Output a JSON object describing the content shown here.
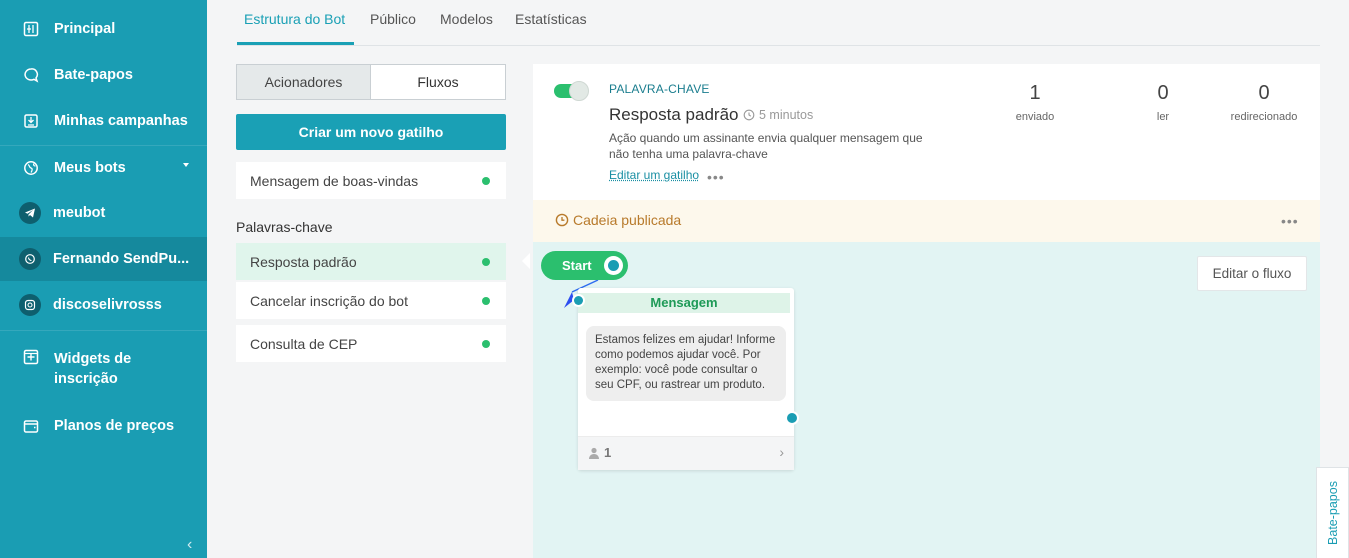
{
  "sidebar": {
    "items": [
      {
        "label": "Principal",
        "icon": "dashboard-icon"
      },
      {
        "label": "Bate-papos",
        "icon": "chat-bubble-icon"
      },
      {
        "label": "Minhas campanhas",
        "icon": "campaign-icon"
      },
      {
        "label": "Meus bots",
        "icon": "globe-icon"
      },
      {
        "label": "meubot",
        "icon": "telegram-icon"
      },
      {
        "label": "Fernando SendPu...",
        "icon": "whatsapp-icon"
      },
      {
        "label": "discoselivrosss",
        "icon": "instagram-icon"
      },
      {
        "label": "Widgets de inscrição",
        "icon": "widget-icon"
      },
      {
        "label": "Planos de preços",
        "icon": "wallet-icon"
      }
    ]
  },
  "tabs": [
    {
      "label": "Estrutura do Bot"
    },
    {
      "label": "Público"
    },
    {
      "label": "Modelos"
    },
    {
      "label": "Estatísticas"
    }
  ],
  "left": {
    "seg_acionadores": "Acionadores",
    "seg_fluxos": "Fluxos",
    "new_trigger": "Criar um novo gatilho",
    "welcome": "Mensagem de boas-vindas",
    "keywords_title": "Palavras-chave",
    "keywords": [
      {
        "label": "Resposta padrão"
      },
      {
        "label": "Cancelar inscrição do bot"
      },
      {
        "label": "Consulta de CEP"
      }
    ]
  },
  "card": {
    "type_label": "PALAVRA-CHAVE",
    "title": "Resposta padrão",
    "time": "5 minutos",
    "description": "Ação quando um assinante envia qualquer mensagem que não tenha uma palavra-chave",
    "edit_link": "Editar um gatilho",
    "more": "•••",
    "stats": [
      {
        "value": "1",
        "label": "enviado"
      },
      {
        "value": "0",
        "label": "ler"
      },
      {
        "value": "0",
        "label": "redirecionado"
      }
    ]
  },
  "published": {
    "text": "Cadeia publicada",
    "more": "•••"
  },
  "flow": {
    "start_label": "Start",
    "edit_flow": "Editar o fluxo",
    "node_title": "Mensagem",
    "node_text": "Estamos felizes em ajudar! Informe como podemos ajudar você. Por exemplo: você pode consultar o seu CPF, ou rastrear um produto.",
    "node_count": "1"
  },
  "chat_tab": "Bate-papos",
  "colors": {
    "sidebar": "#1a9db3",
    "accent": "#1aa0b5",
    "green": "#2bbf6e",
    "published": "#b87a2b"
  }
}
